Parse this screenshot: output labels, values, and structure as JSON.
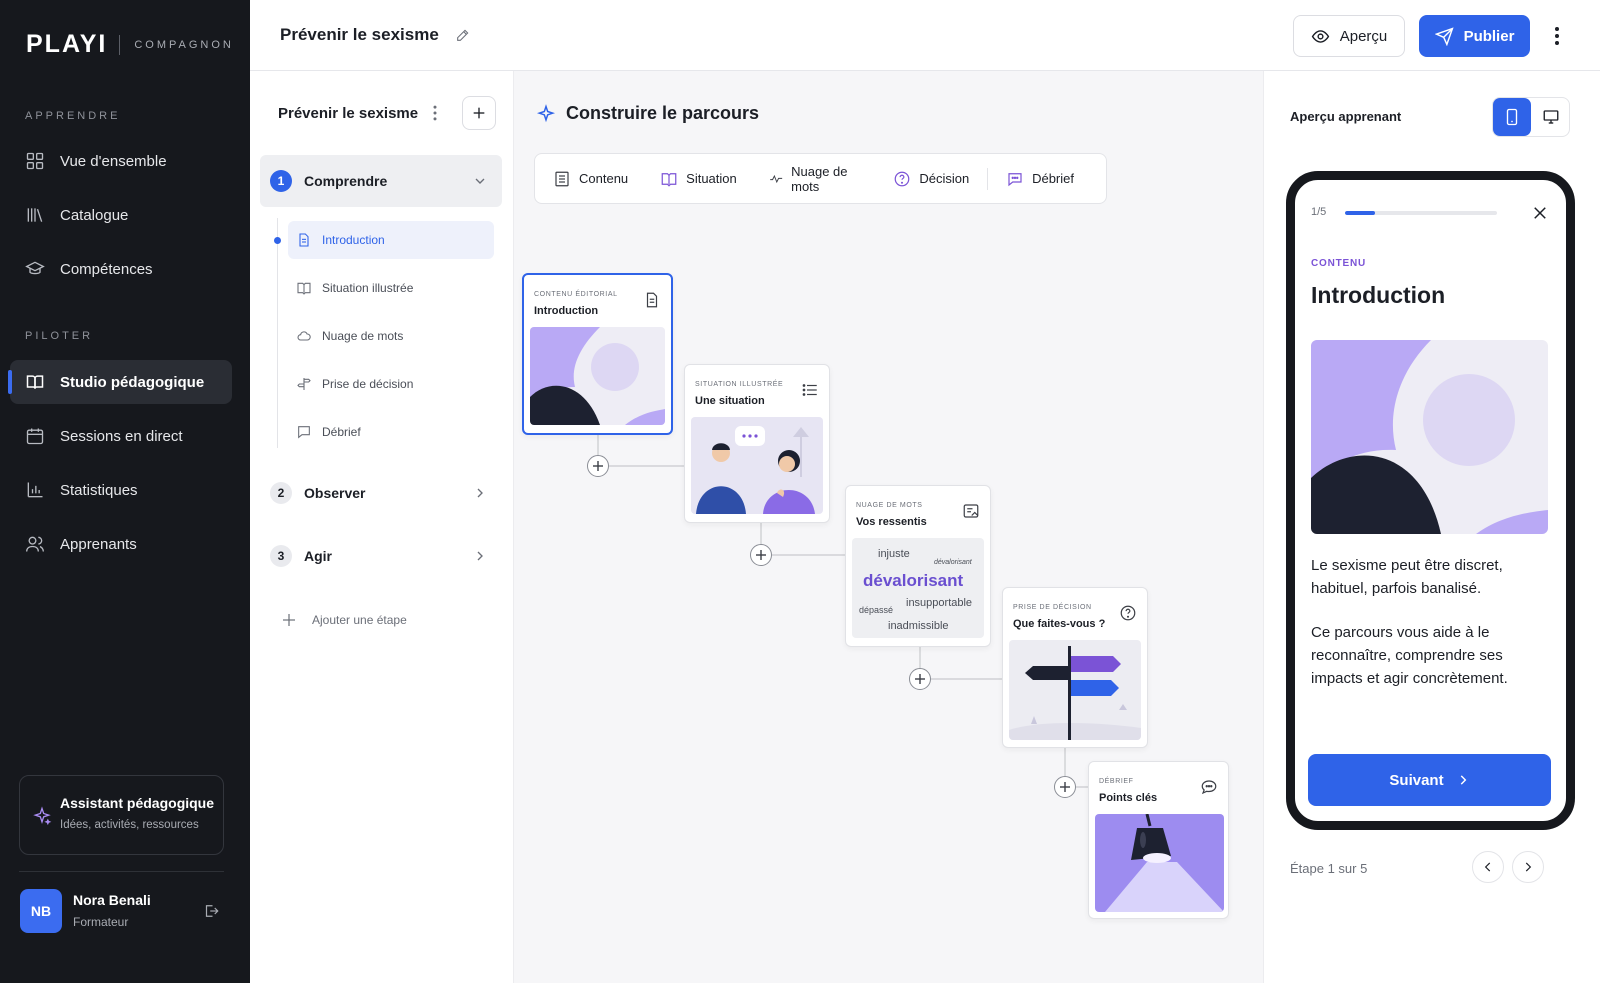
{
  "brand": {
    "logo": "PLAYI",
    "sub": "COMPAGNON"
  },
  "nav": {
    "learn_heading": "APPRENDRE",
    "learn_items": [
      {
        "label": "Vue d'ensemble",
        "icon": "grid-icon"
      },
      {
        "label": "Catalogue",
        "icon": "library-icon"
      },
      {
        "label": "Compétences",
        "icon": "graduation-cap-icon"
      }
    ],
    "pilot_heading": "PILOTER",
    "pilot_items": [
      {
        "label": "Studio pédagogique",
        "icon": "book-open-icon",
        "active": true
      },
      {
        "label": "Sessions en direct",
        "icon": "calendar-icon"
      },
      {
        "label": "Statistiques",
        "icon": "bar-chart-icon"
      },
      {
        "label": "Apprenants",
        "icon": "users-icon"
      }
    ]
  },
  "assistant": {
    "title": "Assistant pédagogique",
    "subtitle": "Idées, activités, ressources"
  },
  "user": {
    "initials": "NB",
    "name": "Nora Benali",
    "role": "Formateur"
  },
  "topbar": {
    "title": "Prévenir le sexisme",
    "preview_label": "Aperçu",
    "publish_label": "Publier"
  },
  "steps_panel": {
    "title": "Prévenir le sexisme",
    "steps": [
      {
        "num": "1",
        "label": "Comprendre",
        "open": true
      },
      {
        "num": "2",
        "label": "Observer"
      },
      {
        "num": "3",
        "label": "Agir"
      }
    ],
    "substeps": [
      {
        "label": "Introduction",
        "icon": "document-icon",
        "active": true
      },
      {
        "label": "Situation illustrée",
        "icon": "book-icon"
      },
      {
        "label": "Nuage de mots",
        "icon": "cloud-icon"
      },
      {
        "label": "Prise de décision",
        "icon": "signpost-icon"
      },
      {
        "label": "Débrief",
        "icon": "chat-icon"
      }
    ],
    "add_step_label": "Ajouter une étape"
  },
  "canvas": {
    "title": "Construire le parcours",
    "tools": [
      {
        "label": "Contenu",
        "icon": "document-icon"
      },
      {
        "label": "Situation",
        "icon": "book-icon"
      },
      {
        "label": "Nuage de mots",
        "icon": "sparkle-line-icon"
      },
      {
        "label": "Décision",
        "icon": "question-circle-icon"
      },
      {
        "label": "Débrief",
        "icon": "chat-icon"
      }
    ],
    "cards": [
      {
        "kicker": "CONTENU ÉDITORIAL",
        "title": "Introduction"
      },
      {
        "kicker": "SITUATION ILLUSTRÉE",
        "title": "Une situation"
      },
      {
        "kicker": "NUAGE DE MOTS",
        "title": "Vos ressentis"
      },
      {
        "kicker": "PRISE DE DÉCISION",
        "title": "Que faites-vous ?"
      },
      {
        "kicker": "DÉBRIEF",
        "title": "Points clés"
      }
    ],
    "wordcloud": [
      "injuste",
      "dévalorisant",
      "dévalorisant",
      "dépassé",
      "insupportable",
      "inadmissible"
    ]
  },
  "preview": {
    "title": "Aperçu apprenant",
    "progress_label": "1/5",
    "progress_fraction": 0.2,
    "kicker": "CONTENU",
    "heading": "Introduction",
    "paragraph1": "Le sexisme peut être discret, habituel, parfois banalisé.",
    "paragraph2": "Ce parcours vous aide à le reconnaître, comprendre ses impacts et agir concrètement.",
    "next_label": "Suivant",
    "step_label": "Étape 1 sur 5"
  },
  "colors": {
    "accent": "#2f63e8",
    "sidebar": "#16181d",
    "purple": "#7b53d6",
    "lavender": "#b9a9f5"
  }
}
